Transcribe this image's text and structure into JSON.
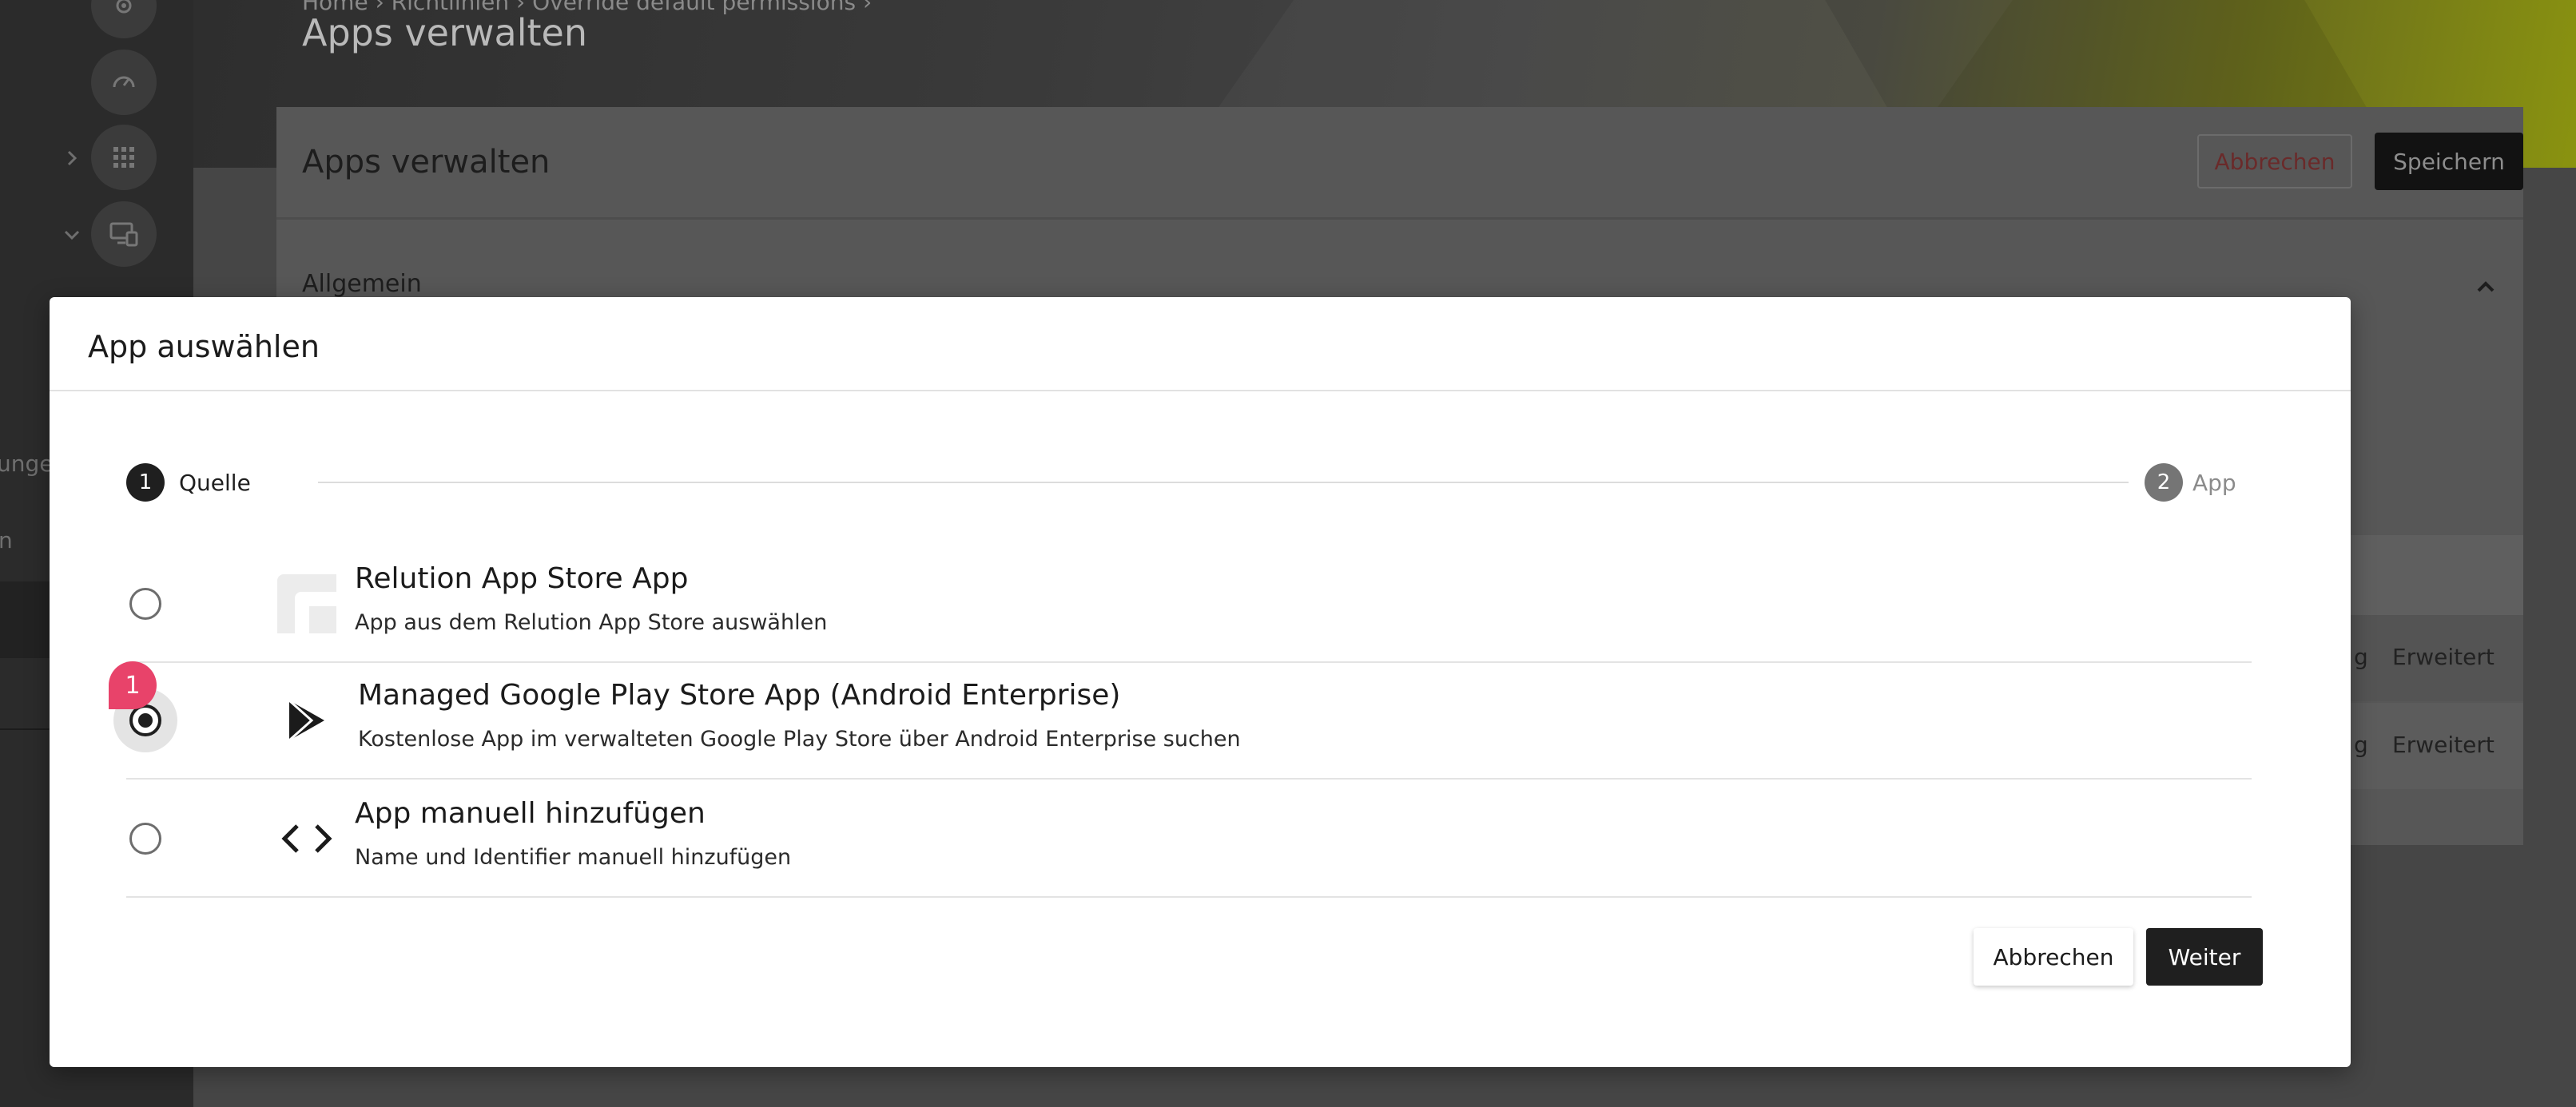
{
  "sidebar": {
    "partial_text_1": "unge",
    "partial_text_2": "n"
  },
  "header": {
    "breadcrumb": "Home › Richtlinien › Override default permissions ›",
    "page_title": "Apps verwalten"
  },
  "card": {
    "title": "Apps verwalten",
    "cancel_label": "Abbrechen",
    "save_label": "Speichern",
    "section_label": "Allgemein",
    "rows": [
      {
        "col_a": "g",
        "col_b": "Erweitert"
      },
      {
        "col_a": "g",
        "col_b": "Erweitert"
      }
    ]
  },
  "modal": {
    "title": "App auswählen",
    "steps": [
      {
        "number": "1",
        "label": "Quelle"
      },
      {
        "number": "2",
        "label": "App"
      }
    ],
    "options": [
      {
        "title": "Relution App Store App",
        "description": "App aus dem Relution App Store auswählen",
        "icon": "relution-logo-icon"
      },
      {
        "title": "Managed Google Play Store App (Android Enterprise)",
        "description": "Kostenlose App im verwalteten Google Play Store über Android Enterprise suchen",
        "icon": "google-play-icon"
      },
      {
        "title": "App manuell hinzufügen",
        "description": "Name und Identifier manuell hinzufügen",
        "icon": "code-icon"
      }
    ],
    "badge": "1",
    "cancel_label": "Abbrechen",
    "next_label": "Weiter"
  }
}
